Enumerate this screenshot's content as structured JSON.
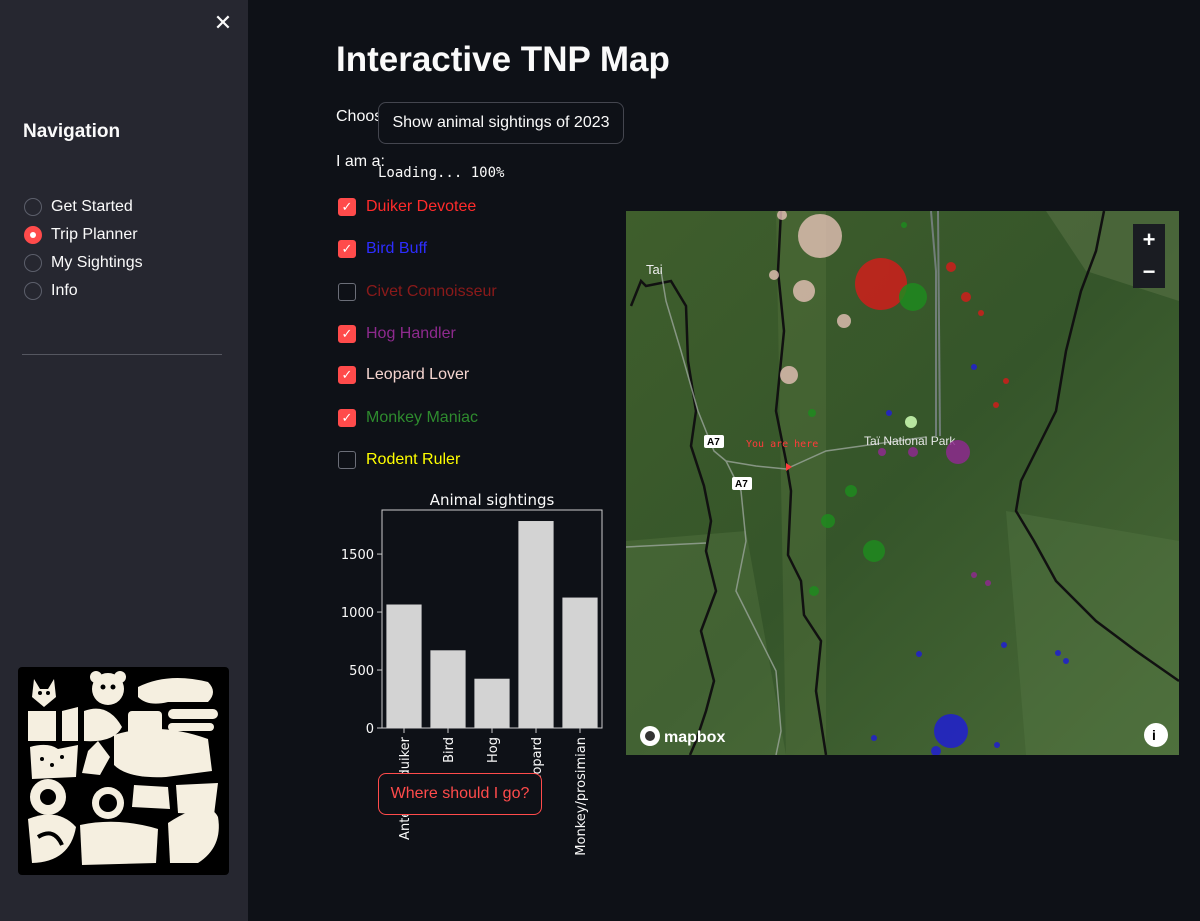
{
  "sidebar": {
    "close_symbol": "✕",
    "nav_title": "Navigation",
    "items": [
      {
        "label": "Get Started",
        "selected": false
      },
      {
        "label": "Trip Planner",
        "selected": true
      },
      {
        "label": "My Sightings",
        "selected": false
      },
      {
        "label": "Info",
        "selected": false
      }
    ]
  },
  "main": {
    "title": "Interactive TNP Map",
    "choose_label": "Choose your favorite animals",
    "iam_label": "I am a:",
    "options": [
      {
        "label": "Duiker Devotee",
        "checked": true,
        "color": "#ff2b2b"
      },
      {
        "label": "Bird Buff",
        "checked": true,
        "color": "#2d2dff"
      },
      {
        "label": "Civet Connoisseur",
        "checked": false,
        "color": "#8b1a1a"
      },
      {
        "label": "Hog Handler",
        "checked": true,
        "color": "#8e2a8e"
      },
      {
        "label": "Leopard Lover",
        "checked": true,
        "color": "#f5d5d0"
      },
      {
        "label": "Monkey Maniac",
        "checked": true,
        "color": "#2e8b2e"
      },
      {
        "label": "Rodent Ruler",
        "checked": false,
        "color": "#ffff00"
      }
    ],
    "show_button": "Show animal sightings of 2023",
    "loading": "Loading... 100%",
    "where_button": "Where should I go?"
  },
  "map": {
    "labels": {
      "town": "Tai",
      "park": "Taï National Park",
      "road1": "A7",
      "road2": "A7",
      "you_are_here": "You are here",
      "attribution": "mapbox"
    },
    "zoom_in": "+",
    "zoom_out": "−",
    "info": "i"
  },
  "chart_data": {
    "type": "bar",
    "title": "Animal sightings",
    "categories": [
      "Antelope/duiker",
      "Bird",
      "Hog",
      "Leopard",
      "Monkey/prosimian"
    ],
    "values": [
      1065,
      670,
      425,
      1785,
      1125
    ],
    "ylim": [
      0,
      1880
    ],
    "yticks": [
      0,
      500,
      1000,
      1500
    ],
    "xlabel": "",
    "ylabel": "",
    "colors": {
      "bar": "#d3d3d3",
      "text": "#fafafa",
      "axis": "#cccccc"
    }
  }
}
